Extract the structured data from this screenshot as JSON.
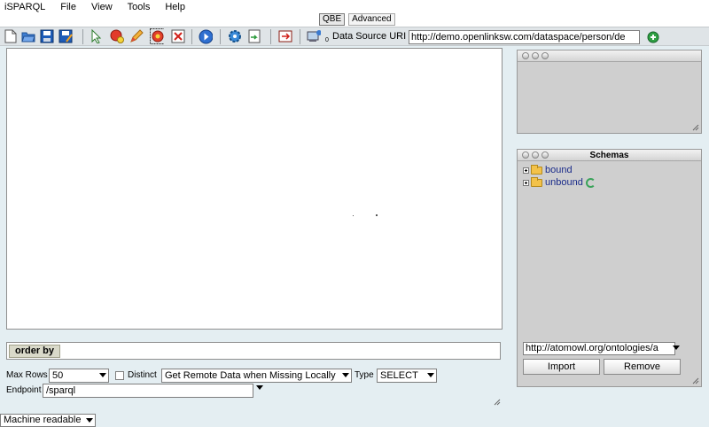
{
  "menubar": {
    "items": [
      "iSPARQL",
      "File",
      "View",
      "Tools",
      "Help"
    ]
  },
  "tabs": [
    {
      "label": "QBE",
      "active": true
    },
    {
      "label": "Advanced",
      "active": false
    }
  ],
  "toolbar": {
    "icons": [
      "new-file-icon",
      "open-folder-icon",
      "save-icon",
      "save-as-icon",
      "pointer-icon",
      "add-node-icon",
      "pencil-icon",
      "gear-red-icon",
      "delete-icon",
      "play-icon",
      "settings-icon",
      "import-icon",
      "export-icon",
      "network-icon"
    ],
    "badge": "0",
    "datasource_label": "Data Source URI",
    "datasource_value": "http://demo.openlinksw.com/dataspace/person/de"
  },
  "orderby": {
    "label": "order by"
  },
  "controls": {
    "max_rows_label": "Max Rows",
    "max_rows_value": "50",
    "distinct_label": "Distinct",
    "fetch_mode": "Get Remote Data when Missing Locally",
    "type_label": "Type",
    "type_value": "SELECT",
    "endpoint_label": "Endpoint",
    "endpoint_value": "/sparql"
  },
  "schemas": {
    "title": "Schemas",
    "items": [
      {
        "label": "bound"
      },
      {
        "label": "unbound"
      }
    ],
    "uri_value": "http://atomowl.org/ontologies/a",
    "import_label": "Import",
    "remove_label": "Remove"
  },
  "output": {
    "format": "Machine readable"
  },
  "colors": {
    "toolbar_bg": "#dfe4e7",
    "main_bg": "#e4eef2",
    "panel_bg": "#cfcfcf",
    "link": "#1a2b8a"
  }
}
